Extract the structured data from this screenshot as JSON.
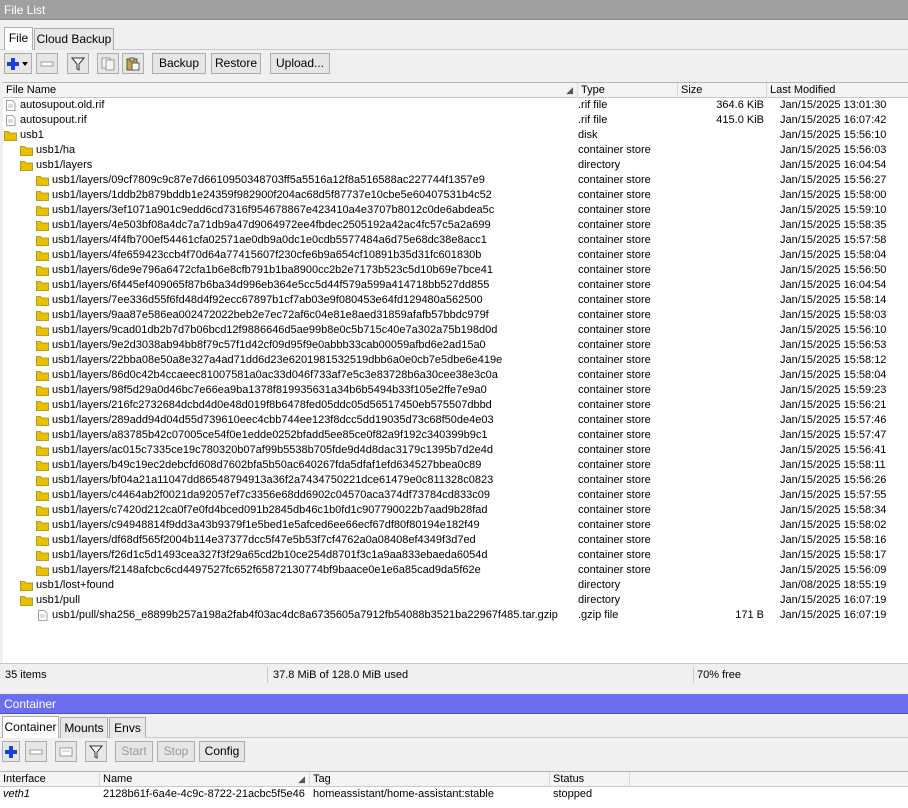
{
  "file_window": {
    "title": "File List",
    "tabs": [
      {
        "label": "File"
      },
      {
        "label": "Cloud Backup"
      }
    ],
    "toolbar": {
      "backup_label": "Backup",
      "restore_label": "Restore",
      "upload_label": "Upload..."
    },
    "columns": {
      "name": "File Name",
      "type": "Type",
      "size": "Size",
      "modified": "Last Modified"
    },
    "rows": [
      {
        "level": 0,
        "icon": "file",
        "name": "autosupout.old.rif",
        "type": ".rif file",
        "size": "364.6 KiB",
        "modified": "Jan/15/2025 13:01:30"
      },
      {
        "level": 0,
        "icon": "file",
        "name": "autosupout.rif",
        "type": ".rif file",
        "size": "415.0 KiB",
        "modified": "Jan/15/2025 16:07:42"
      },
      {
        "level": 0,
        "icon": "folder",
        "name": "usb1",
        "type": "disk",
        "size": "",
        "modified": "Jan/15/2025 15:56:10"
      },
      {
        "level": 1,
        "icon": "folder",
        "name": "usb1/ha",
        "type": "container store",
        "size": "",
        "modified": "Jan/15/2025 15:56:03"
      },
      {
        "level": 1,
        "icon": "folder",
        "name": "usb1/layers",
        "type": "directory",
        "size": "",
        "modified": "Jan/15/2025 16:04:54"
      },
      {
        "level": 2,
        "icon": "folder",
        "name": "usb1/layers/09cf7809c9c87e7d6610950348703ff5a5516a12f8a516588ac227744f1357e9",
        "type": "container store",
        "size": "",
        "modified": "Jan/15/2025 15:56:27"
      },
      {
        "level": 2,
        "icon": "folder",
        "name": "usb1/layers/1ddb2b879bddb1e24359f982900f204ac68d5f87737e10cbe5e60407531b4c52",
        "type": "container store",
        "size": "",
        "modified": "Jan/15/2025 15:58:00"
      },
      {
        "level": 2,
        "icon": "folder",
        "name": "usb1/layers/3ef1071a901c9edd6cd7316f954678867e423410a4e3707b8012c0de6abdea5c",
        "type": "container store",
        "size": "",
        "modified": "Jan/15/2025 15:59:10"
      },
      {
        "level": 2,
        "icon": "folder",
        "name": "usb1/layers/4e503bf08a4dc7a71db9a47d9064972ee4fbdec2505192a42ac4fc57c5a2a699",
        "type": "container store",
        "size": "",
        "modified": "Jan/15/2025 15:58:35"
      },
      {
        "level": 2,
        "icon": "folder",
        "name": "usb1/layers/4f4fb700ef54461cfa02571ae0db9a0dc1e0cdb5577484a6d75e68dc38e8acc1",
        "type": "container store",
        "size": "",
        "modified": "Jan/15/2025 15:57:58"
      },
      {
        "level": 2,
        "icon": "folder",
        "name": "usb1/layers/4fe659423ccb4f70d64a77415607f230cfe6b9a654cf10891b35d31fc601830b",
        "type": "container store",
        "size": "",
        "modified": "Jan/15/2025 15:58:04"
      },
      {
        "level": 2,
        "icon": "folder",
        "name": "usb1/layers/6de9e796a6472cfa1b6e8cfb791b1ba8900cc2b2e7173b523c5d10b69e7bce41",
        "type": "container store",
        "size": "",
        "modified": "Jan/15/2025 15:56:50"
      },
      {
        "level": 2,
        "icon": "folder",
        "name": "usb1/layers/6f445ef409065f87b6ba34d996eb364e5cc5d44f579a599a414718bb527dd855",
        "type": "container store",
        "size": "",
        "modified": "Jan/15/2025 16:04:54"
      },
      {
        "level": 2,
        "icon": "folder",
        "name": "usb1/layers/7ee336d55f6fd48d4f92ecc67897b1cf7ab03e9f080453e64fd129480a562500",
        "type": "container store",
        "size": "",
        "modified": "Jan/15/2025 15:58:14"
      },
      {
        "level": 2,
        "icon": "folder",
        "name": "usb1/layers/9aa87e586ea002472022beb2e7ec72af6c04e81e8aed31859afafb57bbdc979f",
        "type": "container store",
        "size": "",
        "modified": "Jan/15/2025 15:58:03"
      },
      {
        "level": 2,
        "icon": "folder",
        "name": "usb1/layers/9cad01db2b7d7b06bcd12f9886646d5ae99b8e0c5b715c40e7a302a75b198d0d",
        "type": "container store",
        "size": "",
        "modified": "Jan/15/2025 15:56:10"
      },
      {
        "level": 2,
        "icon": "folder",
        "name": "usb1/layers/9e2d3038ab94bb8f79c57f1d42cf09d95f9e0abbb33cab00059afbd6e2ad15a0",
        "type": "container store",
        "size": "",
        "modified": "Jan/15/2025 15:56:53"
      },
      {
        "level": 2,
        "icon": "folder",
        "name": "usb1/layers/22bba08e50a8e327a4ad71dd6d23e6201981532519dbb6a0e0cb7e5dbe6e419e",
        "type": "container store",
        "size": "",
        "modified": "Jan/15/2025 15:58:12"
      },
      {
        "level": 2,
        "icon": "folder",
        "name": "usb1/layers/86d0c42b4ccaeec81007581a0ac33d046f733af7e5c3e83728b6a30cee38e3c0a",
        "type": "container store",
        "size": "",
        "modified": "Jan/15/2025 15:58:04"
      },
      {
        "level": 2,
        "icon": "folder",
        "name": "usb1/layers/98f5d29a0d46bc7e66ea9ba1378f819935631a34b6b5494b33f105e2ffe7e9a0",
        "type": "container store",
        "size": "",
        "modified": "Jan/15/2025 15:59:23"
      },
      {
        "level": 2,
        "icon": "folder",
        "name": "usb1/layers/216fc2732684dcbd4d0e48d019f8b6478fed05ddc05d56517450eb575507dbbd",
        "type": "container store",
        "size": "",
        "modified": "Jan/15/2025 15:56:21"
      },
      {
        "level": 2,
        "icon": "folder",
        "name": "usb1/layers/289add94d04d55d739610eec4cbb744ee123f8dcc5dd19035d73c68f50de4e03",
        "type": "container store",
        "size": "",
        "modified": "Jan/15/2025 15:57:46"
      },
      {
        "level": 2,
        "icon": "folder",
        "name": "usb1/layers/a83785b42c07005ce54f0e1edde0252bfadd5ee85ce0f82a9f192c340399b9c1",
        "type": "container store",
        "size": "",
        "modified": "Jan/15/2025 15:57:47"
      },
      {
        "level": 2,
        "icon": "folder",
        "name": "usb1/layers/ac015c7335ce19c780320b07af99b5538b705fde9d4d8dac3179c1395b7d2e4d",
        "type": "container store",
        "size": "",
        "modified": "Jan/15/2025 15:56:41"
      },
      {
        "level": 2,
        "icon": "folder",
        "name": "usb1/layers/b49c19ec2debcfd608d7602bfa5b50ac640267fda5dfaf1efd634527bbea0c89",
        "type": "container store",
        "size": "",
        "modified": "Jan/15/2025 15:58:11"
      },
      {
        "level": 2,
        "icon": "folder",
        "name": "usb1/layers/bf04a21a11047dd86548794913a36f2a7434750221dce61479e0c811328c0823",
        "type": "container store",
        "size": "",
        "modified": "Jan/15/2025 15:56:26"
      },
      {
        "level": 2,
        "icon": "folder",
        "name": "usb1/layers/c4464ab2f0021da92057ef7c3356e68dd6902c04570aca374df73784cd833c09",
        "type": "container store",
        "size": "",
        "modified": "Jan/15/2025 15:57:55"
      },
      {
        "level": 2,
        "icon": "folder",
        "name": "usb1/layers/c7420d212ca0f7e0fd4bced091b2845db46c1b0fd1c907790022b7aad9b28fad",
        "type": "container store",
        "size": "",
        "modified": "Jan/15/2025 15:58:34"
      },
      {
        "level": 2,
        "icon": "folder",
        "name": "usb1/layers/c94948814f9dd3a43b9379f1e5bed1e5afced6ee66ecf67df80f80194e182f49",
        "type": "container store",
        "size": "",
        "modified": "Jan/15/2025 15:58:02"
      },
      {
        "level": 2,
        "icon": "folder",
        "name": "usb1/layers/df68df565f2004b114e37377dcc5f47e5b53f7cf4762a0a08408ef4349f3d7ed",
        "type": "container store",
        "size": "",
        "modified": "Jan/15/2025 15:58:16"
      },
      {
        "level": 2,
        "icon": "folder",
        "name": "usb1/layers/f26d1c5d1493cea327f3f29a65cd2b10ce254d8701f3c1a9aa833ebaeda6054d",
        "type": "container store",
        "size": "",
        "modified": "Jan/15/2025 15:58:17"
      },
      {
        "level": 2,
        "icon": "folder",
        "name": "usb1/layers/f2148afcbc6cd4497527fc652f65872130774bf9baace0e1e6a85cad9da5f62e",
        "type": "container store",
        "size": "",
        "modified": "Jan/15/2025 15:56:09"
      },
      {
        "level": 1,
        "icon": "folder",
        "name": "usb1/lost+found",
        "type": "directory",
        "size": "",
        "modified": "Jan/08/2025 18:55:19"
      },
      {
        "level": 1,
        "icon": "folder",
        "name": "usb1/pull",
        "type": "directory",
        "size": "",
        "modified": "Jan/15/2025 16:07:19"
      },
      {
        "level": 2,
        "icon": "file",
        "name": "usb1/pull/sha256_e8899b257a198a2fab4f03ac4dc8a6735605a7912fb54088b3521ba22967f485.tar.gzip",
        "type": ".gzip file",
        "size": "171 B",
        "modified": "Jan/15/2025 16:07:19"
      }
    ],
    "status": {
      "items": "35 items",
      "usage": "37.8 MiB of 128.0 MiB used",
      "free": "70% free"
    }
  },
  "container_window": {
    "title": "Container",
    "tabs": [
      {
        "label": "Container"
      },
      {
        "label": "Mounts"
      },
      {
        "label": "Envs"
      }
    ],
    "toolbar": {
      "start_label": "Start",
      "stop_label": "Stop",
      "config_label": "Config"
    },
    "columns": {
      "interface": "Interface",
      "name": "Name",
      "tag": "Tag",
      "status": "Status"
    },
    "rows": [
      {
        "interface": "veth1",
        "name": "2128b61f-6a4e-4c9c-8722-21acbc5f5e46",
        "tag": "homeassistant/home-assistant:stable",
        "status": "stopped"
      }
    ]
  },
  "colors": {
    "folder": "#e8c000",
    "active_title": "#6d6df0",
    "inactive_title": "#a0a0a0",
    "add_icon": "#1a3fd6"
  }
}
